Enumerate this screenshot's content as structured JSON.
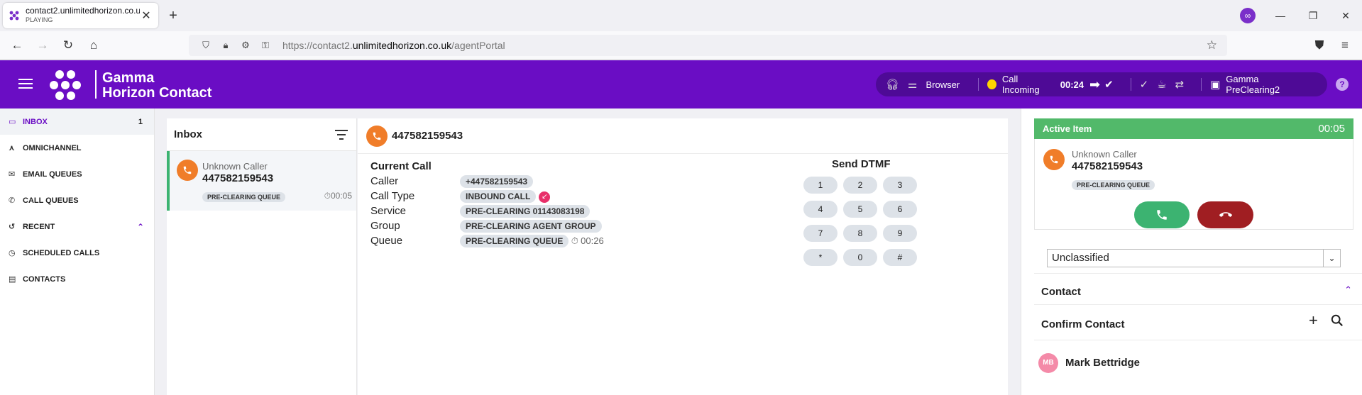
{
  "browser": {
    "tab_title": "contact2.unlimitedhorizon.co.uk",
    "tab_status": "PLAYING",
    "url_prefix": "https://contact2.",
    "url_domain": "unlimitedhorizon.co.uk",
    "url_path": "/agentPortal"
  },
  "header": {
    "brand_line1": "Gamma",
    "brand_line2": "Horizon Contact",
    "device_label": "Browser",
    "call_status": "Call Incoming",
    "call_timer": "00:24",
    "agent_name": "Gamma PreClearing2",
    "accent": "#6a0dc4"
  },
  "leftnav": {
    "inbox": "INBOX",
    "inbox_count": "1",
    "omnichannel": "OMNICHANNEL",
    "email_queues": "EMAIL QUEUES",
    "call_queues": "CALL QUEUES",
    "recent": "RECENT",
    "scheduled_calls": "SCHEDULED CALLS",
    "contacts": "CONTACTS"
  },
  "inbox": {
    "title": "Inbox",
    "item": {
      "caller": "Unknown Caller",
      "number": "447582159543",
      "queue": "PRE-CLEARING QUEUE",
      "time": "00:05"
    }
  },
  "call": {
    "number": "447582159543",
    "section_title": "Current Call",
    "rows": {
      "caller_label": "Caller",
      "caller_value": "+447582159543",
      "type_label": "Call Type",
      "type_value": "INBOUND CALL",
      "service_label": "Service",
      "service_value": "PRE-CLEARING 01143083198",
      "group_label": "Group",
      "group_value": "PRE-CLEARING AGENT GROUP",
      "queue_label": "Queue",
      "queue_value": "PRE-CLEARING QUEUE",
      "queue_time": "00:26"
    },
    "dtmf_title": "Send DTMF",
    "dtmf_keys": [
      "1",
      "2",
      "3",
      "4",
      "5",
      "6",
      "7",
      "8",
      "9",
      "*",
      "0",
      "#"
    ]
  },
  "active": {
    "title": "Active Item",
    "timer": "00:05",
    "caller": "Unknown Caller",
    "number": "447582159543",
    "queue": "PRE-CLEARING QUEUE",
    "classification": "Unclassified",
    "contact_section": "Contact",
    "confirm_contact": "Confirm Contact",
    "contact_initials": "MB",
    "contact_name": "Mark Bettridge"
  }
}
